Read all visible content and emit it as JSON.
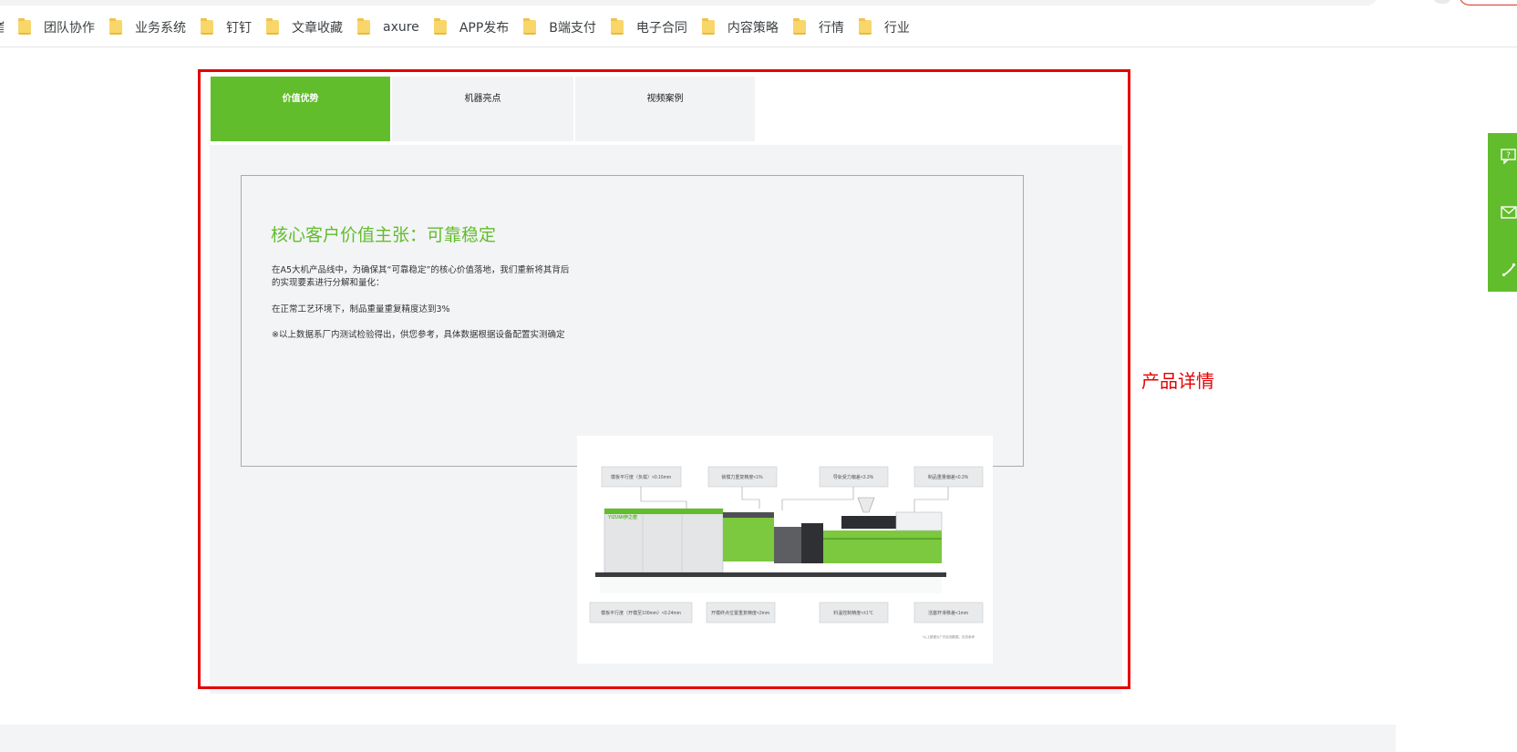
{
  "bookmarks_bar": {
    "edge_text": "首",
    "items": [
      {
        "label": "团队协作"
      },
      {
        "label": "业务系统"
      },
      {
        "label": "钉钉"
      },
      {
        "label": "文章收藏"
      },
      {
        "label": "axure"
      },
      {
        "label": "APP发布"
      },
      {
        "label": "B端支付"
      },
      {
        "label": "电子合同"
      },
      {
        "label": "内容策略"
      },
      {
        "label": "行情"
      },
      {
        "label": "行业"
      }
    ]
  },
  "tabs": [
    {
      "label": "价值优势",
      "active": true
    },
    {
      "label": "机器亮点",
      "active": false
    },
    {
      "label": "视频案例",
      "active": false
    }
  ],
  "content": {
    "title": "核心客户价值主张：可靠稳定",
    "paragraph1": "在A5大机产品线中，为确保其“可靠稳定”的核心价值落地，我们重新将其背后的实现要素进行分解和量化：",
    "paragraph2": "在正常工艺环境下，制品重量重复精度达到3%",
    "paragraph3": "※以上数据系厂内测试检验得出，供您参考，具体数据根据设备配置实测确定"
  },
  "machine_image": {
    "labels_top": [
      "模板平行度（负载）<0.16mm",
      "锁模力重复精度<1%",
      "导轨受力偏差<3.3%",
      "制品重量偏差<0.3%"
    ],
    "labels_bottom": [
      "模板平行度（开模至100mm）<0.24mm",
      "开模终点位置重复精度<2mm",
      "料温控制精度<±1℃",
      "活塞杆滑移差<1mm"
    ],
    "brand_text": "YIZUMI伊之密",
    "footnote": "*以上数据为厂内实测数据，仅供参考"
  },
  "annotation": {
    "label": "产品详情"
  },
  "colors": {
    "accent_green": "#62bd2c",
    "highlight_red": "#e60000",
    "panel_bg": "#f3f4f6"
  },
  "floating_toolbar": {
    "icons": [
      "question-chat-icon",
      "mail-icon",
      "phone-icon"
    ]
  }
}
